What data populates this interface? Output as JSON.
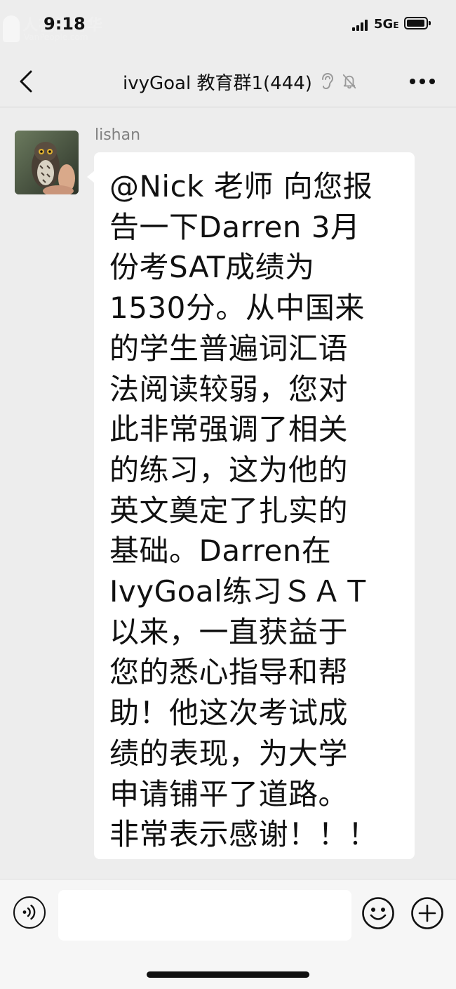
{
  "status_bar": {
    "time": "9:18",
    "network": "5G",
    "network_suffix": "E",
    "watermark_cn": "人在温哥华",
    "watermark_en": "VanPeople.com"
  },
  "header": {
    "title": "ivyGoal 教育群1(444)",
    "ear_icon": "ear-icon",
    "mute_icon": "muted-bell-icon"
  },
  "message": {
    "sender": "lishan",
    "lines": [
      "@Nick 老师 向您报",
      "告一下Darren 3月",
      "份考SAT成绩为",
      "1530分。从中国来",
      "的学生普遍词汇语",
      "法阅读较弱，您对",
      "此非常强调了相关",
      "的练习，这为他的",
      "英文奠定了扎实的",
      "基础。Darren在",
      "IvyGoal练习ＳＡＴ",
      "以来，一直获益于",
      "您的悉心指导和帮",
      "助！他这次考试成",
      "绩的表现，为大学",
      "申请铺平了道路。",
      "非常表示感谢！！！"
    ]
  },
  "input": {
    "value": "",
    "placeholder": ""
  },
  "colors": {
    "background": "#ededed",
    "bubble": "#ffffff",
    "sender_text": "#808080"
  }
}
